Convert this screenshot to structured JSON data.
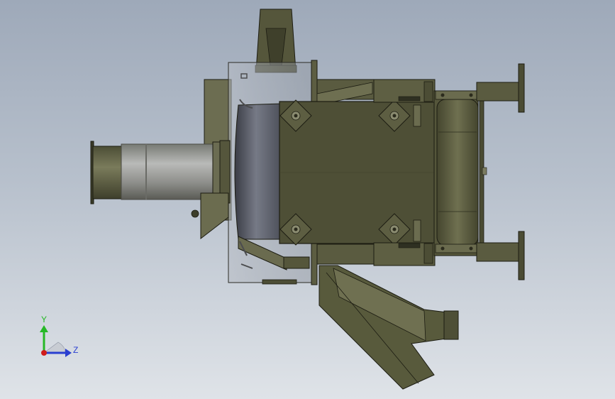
{
  "viewport": {
    "background_top": "#9ea9b9",
    "background_bottom": "#dfe3e8"
  },
  "model": {
    "body_color": "#4e4f36",
    "body_light": "#707152",
    "edge_color": "#1c1c12",
    "sleeve_color": "#5d6069",
    "pipe_color": "#8e8f8f"
  },
  "triad": {
    "y_label": "Y",
    "z_label": "Z",
    "y_color": "#26b826",
    "z_color": "#2a3fd0",
    "origin_color": "#d01b1b"
  }
}
